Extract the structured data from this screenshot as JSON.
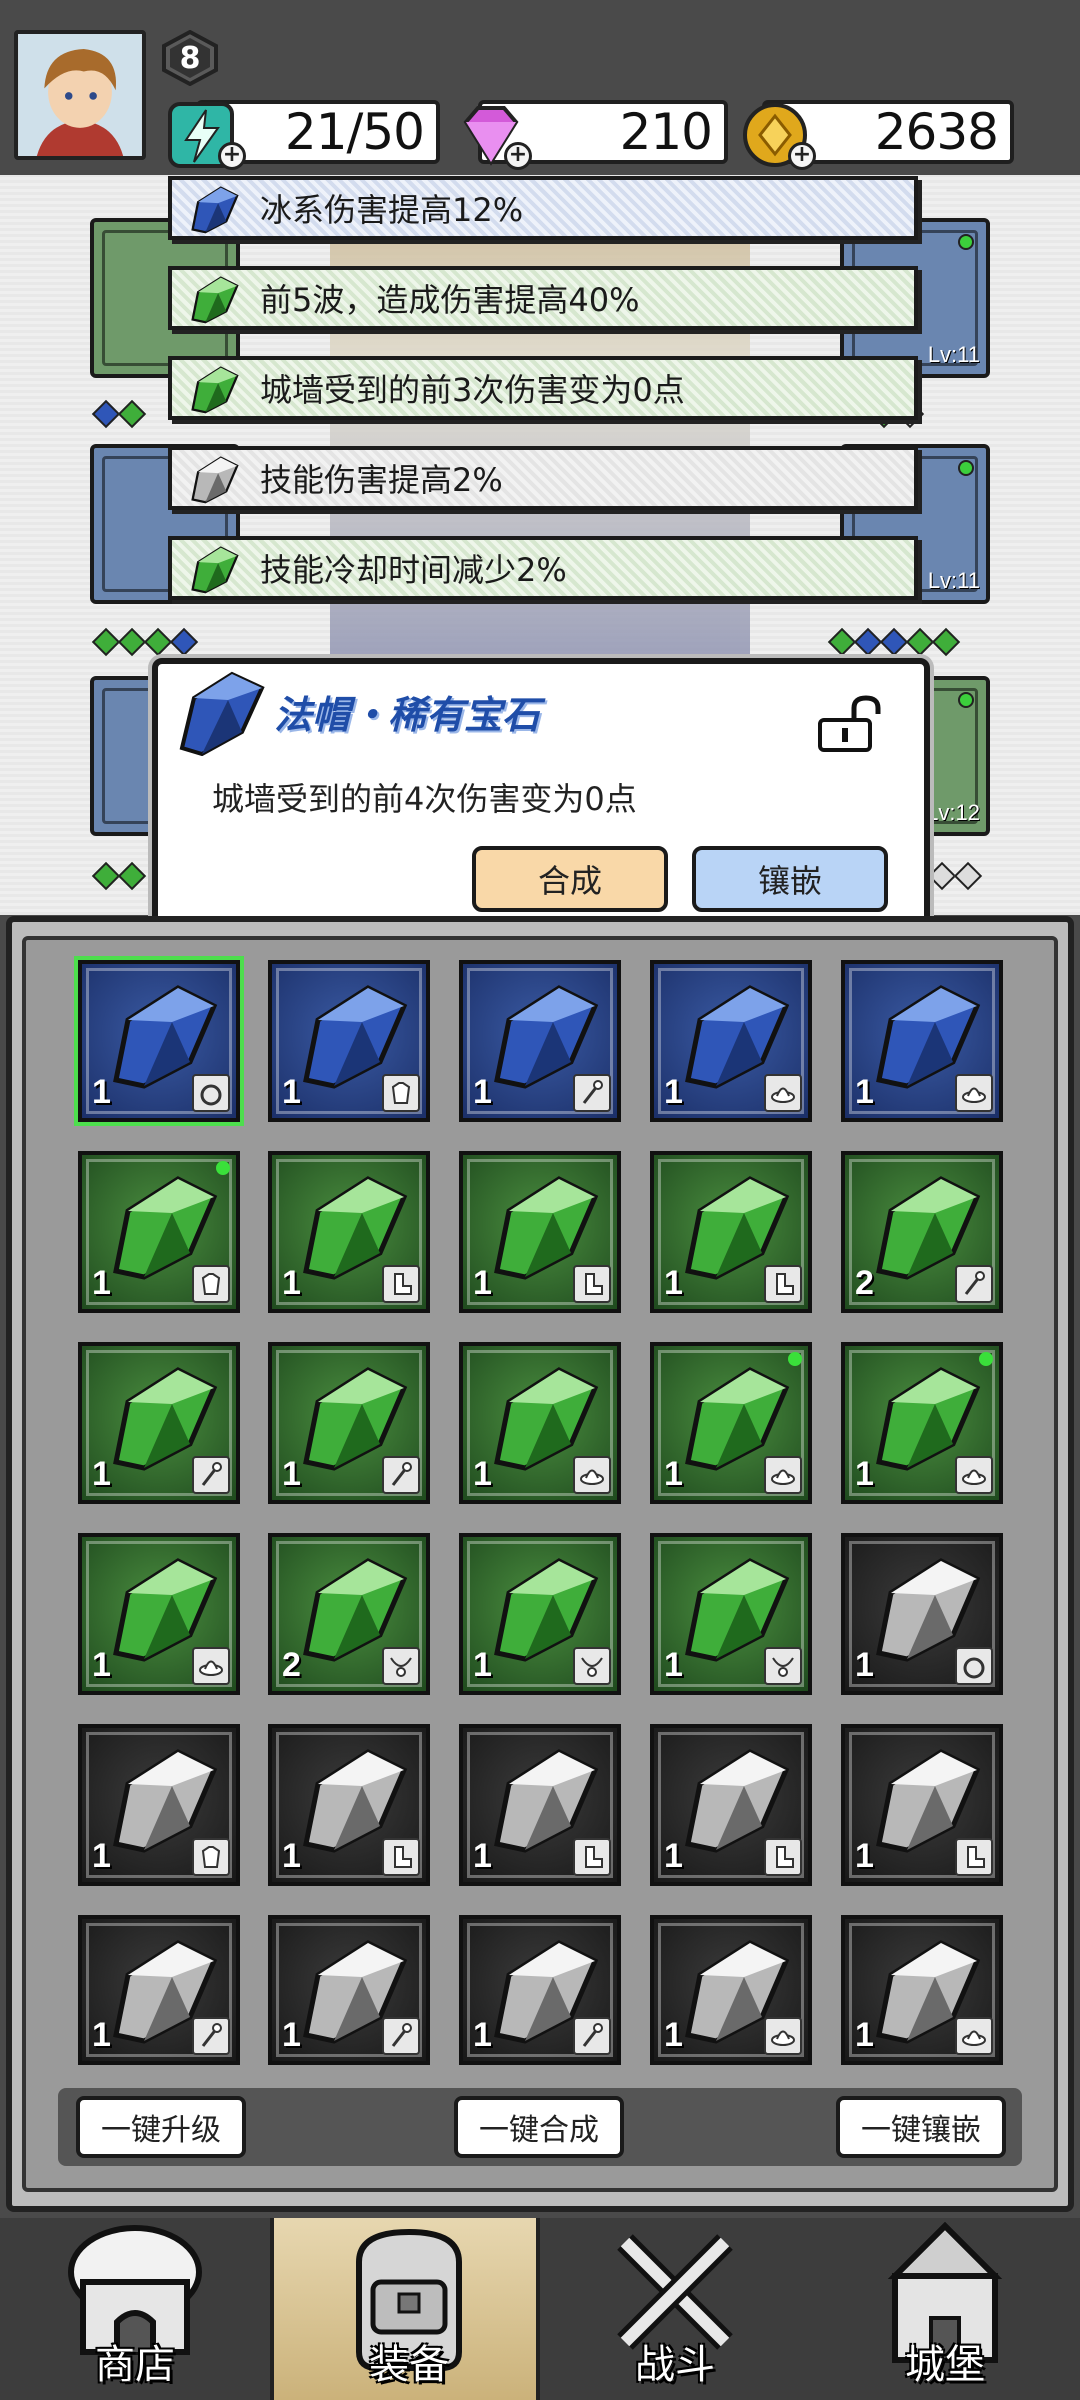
{
  "player": {
    "level": "8"
  },
  "resources": {
    "energy": "21/50",
    "gems": "210",
    "coins": "2638"
  },
  "equip_slots": {
    "levels": [
      "Lv:11",
      "Lv:11",
      "Lv:12"
    ]
  },
  "bonuses": [
    {
      "text": "冰系伤害提高12%",
      "color": "blue"
    },
    {
      "text": "前5波，造成伤害提高40%",
      "color": "green"
    },
    {
      "text": "城墙受到的前3次伤害变为0点",
      "color": "green"
    },
    {
      "text": "技能伤害提高2%",
      "color": "gray"
    },
    {
      "text": "技能冷却时间减少2%",
      "color": "green"
    }
  ],
  "popup": {
    "title": "法帽・稀有宝石",
    "description": "城墙受到的前4次伤害变为0点",
    "merge_label": "合成",
    "embed_label": "镶嵌"
  },
  "inventory": [
    {
      "color": "blue",
      "count": "1",
      "tag": "ring",
      "selected": true,
      "dot": false
    },
    {
      "color": "blue",
      "count": "1",
      "tag": "armor",
      "selected": false,
      "dot": false
    },
    {
      "color": "blue",
      "count": "1",
      "tag": "staff",
      "selected": false,
      "dot": false
    },
    {
      "color": "blue",
      "count": "1",
      "tag": "hat",
      "selected": false,
      "dot": false
    },
    {
      "color": "blue",
      "count": "1",
      "tag": "hat",
      "selected": false,
      "dot": false
    },
    {
      "color": "green",
      "count": "1",
      "tag": "armor",
      "selected": false,
      "dot": true
    },
    {
      "color": "green",
      "count": "1",
      "tag": "boot",
      "selected": false,
      "dot": false
    },
    {
      "color": "green",
      "count": "1",
      "tag": "boot",
      "selected": false,
      "dot": false
    },
    {
      "color": "green",
      "count": "1",
      "tag": "boot",
      "selected": false,
      "dot": false
    },
    {
      "color": "green",
      "count": "2",
      "tag": "staff",
      "selected": false,
      "dot": false
    },
    {
      "color": "green",
      "count": "1",
      "tag": "staff",
      "selected": false,
      "dot": false
    },
    {
      "color": "green",
      "count": "1",
      "tag": "staff",
      "selected": false,
      "dot": false
    },
    {
      "color": "green",
      "count": "1",
      "tag": "hat",
      "selected": false,
      "dot": false
    },
    {
      "color": "green",
      "count": "1",
      "tag": "hat",
      "selected": false,
      "dot": true
    },
    {
      "color": "green",
      "count": "1",
      "tag": "hat",
      "selected": false,
      "dot": true
    },
    {
      "color": "green",
      "count": "1",
      "tag": "hat",
      "selected": false,
      "dot": false
    },
    {
      "color": "green",
      "count": "2",
      "tag": "necklace",
      "selected": false,
      "dot": false
    },
    {
      "color": "green",
      "count": "1",
      "tag": "necklace",
      "selected": false,
      "dot": false
    },
    {
      "color": "green",
      "count": "1",
      "tag": "necklace",
      "selected": false,
      "dot": false
    },
    {
      "color": "gray",
      "count": "1",
      "tag": "ring",
      "selected": false,
      "dot": false
    },
    {
      "color": "gray",
      "count": "1",
      "tag": "armor",
      "selected": false,
      "dot": false
    },
    {
      "color": "gray",
      "count": "1",
      "tag": "boot",
      "selected": false,
      "dot": false
    },
    {
      "color": "gray",
      "count": "1",
      "tag": "boot",
      "selected": false,
      "dot": false
    },
    {
      "color": "gray",
      "count": "1",
      "tag": "boot",
      "selected": false,
      "dot": false
    },
    {
      "color": "gray",
      "count": "1",
      "tag": "boot",
      "selected": false,
      "dot": false
    },
    {
      "color": "gray",
      "count": "1",
      "tag": "staff",
      "selected": false,
      "dot": false
    },
    {
      "color": "gray",
      "count": "1",
      "tag": "staff",
      "selected": false,
      "dot": false
    },
    {
      "color": "gray",
      "count": "1",
      "tag": "staff",
      "selected": false,
      "dot": false
    },
    {
      "color": "gray",
      "count": "1",
      "tag": "hat",
      "selected": false,
      "dot": false
    },
    {
      "color": "gray",
      "count": "1",
      "tag": "hat",
      "selected": false,
      "dot": false
    }
  ],
  "actions": {
    "upgrade_all": "一键升级",
    "merge_all": "一键合成",
    "embed_all": "一键镶嵌"
  },
  "nav": {
    "shop": "商店",
    "equip": "装备",
    "battle": "战斗",
    "castle": "城堡"
  },
  "colors": {
    "blue_gem": "#2f56b8",
    "green_gem": "#3fae3a",
    "gray_gem": "#bdbdbd",
    "title_blue": "#1f4da8",
    "accent_green": "#3ae03a"
  }
}
